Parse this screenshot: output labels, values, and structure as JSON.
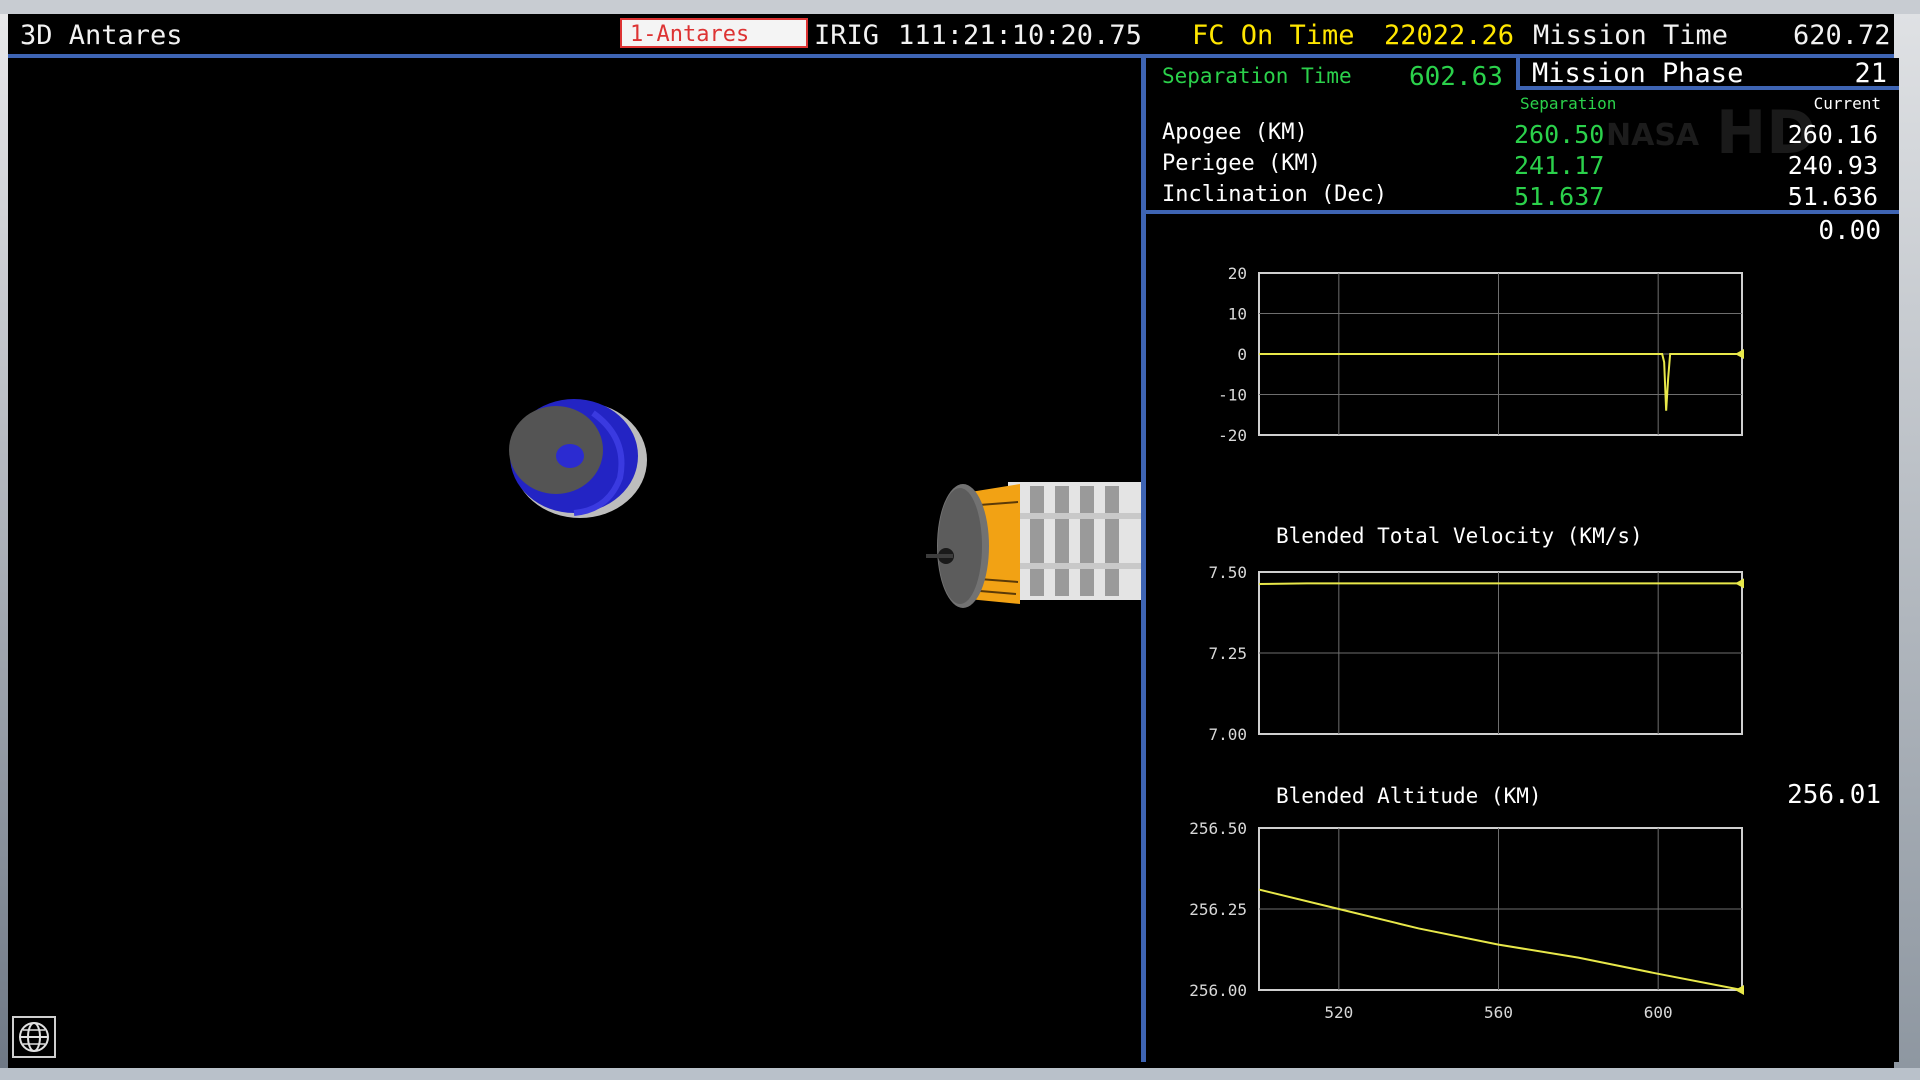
{
  "header": {
    "app_title": "3D Antares",
    "vehicle_select": "1-Antares",
    "irig_label": "IRIG",
    "irig_value": "111:21:10:20.75",
    "fc_label": "FC On Time",
    "fc_value": "22022.26",
    "mission_time_label": "Mission Time",
    "mission_time_value": "620.72"
  },
  "panel": {
    "separation_time_label": "Separation Time",
    "separation_time_value": "602.63",
    "mission_phase_label": "Mission Phase",
    "mission_phase_value": "21",
    "col_separation": "Separation",
    "col_current": "Current",
    "orbit_rows": [
      {
        "label": "Apogee (KM)",
        "separation": "260.50",
        "current": "260.16"
      },
      {
        "label": "Perigee (KM)",
        "separation": "241.17",
        "current": "240.93"
      },
      {
        "label": "Inclination (Dec)",
        "separation": "51.637",
        "current": "51.636"
      }
    ],
    "top_chart_readout": "0.00",
    "watermark_hd": "HD",
    "watermark_nasa": "NASA"
  },
  "colors": {
    "accent_blue": "#3e64b3",
    "trace_yellow": "#e8e84a",
    "separation_green": "#2bd14b",
    "fc_yellow": "#ffe600"
  },
  "icons": {
    "viewport_globe": "globe-icon"
  },
  "chart_data": [
    {
      "type": "line",
      "title": "",
      "ylim": [
        -20,
        20
      ],
      "yticks": [
        "20",
        "10",
        "0",
        "-10",
        "-20"
      ],
      "xlim": [
        500,
        621
      ],
      "grid": true,
      "series": [
        {
          "x": [
            500,
            601,
            601.5,
            602,
            602.5,
            603,
            621
          ],
          "y": [
            0,
            0,
            -2,
            -14,
            -6,
            0,
            0
          ]
        }
      ]
    },
    {
      "type": "line",
      "title": "Blended Total Velocity (KM/s)",
      "ylim": [
        7.0,
        7.5
      ],
      "yticks": [
        "7.50",
        "7.25",
        "7.00"
      ],
      "xlim": [
        500,
        621
      ],
      "grid": true,
      "series": [
        {
          "x": [
            500,
            512,
            621
          ],
          "y": [
            7.463,
            7.465,
            7.465
          ]
        }
      ]
    },
    {
      "type": "line",
      "title": "Blended Altitude (KM)",
      "readout": "256.01",
      "ylim": [
        256.0,
        256.5
      ],
      "yticks": [
        "256.50",
        "256.25",
        "256.00"
      ],
      "xlim": [
        500,
        621
      ],
      "xticks": [
        "520",
        "560",
        "600"
      ],
      "grid": true,
      "series": [
        {
          "x": [
            500,
            520,
            540,
            560,
            580,
            600,
            621
          ],
          "y": [
            256.31,
            256.25,
            256.19,
            256.14,
            256.1,
            256.05,
            256.0
          ]
        }
      ]
    }
  ]
}
